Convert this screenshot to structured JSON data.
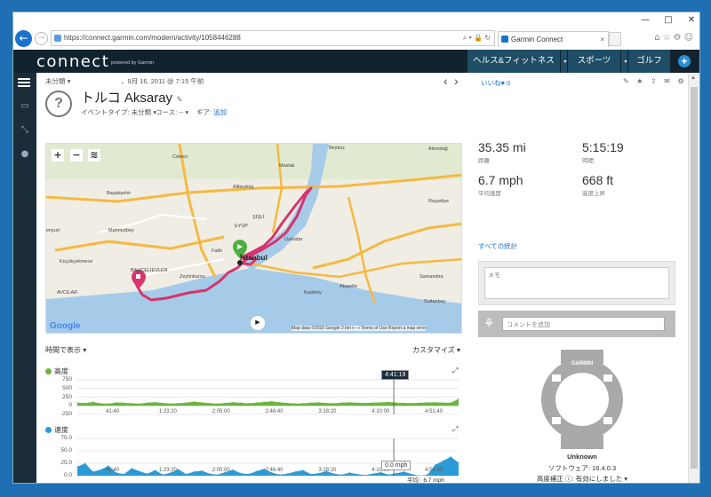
{
  "browser": {
    "url": "https://connect.garmin.com/modern/activity/1058446288",
    "tab_title": "Garmin Connect",
    "tab_close": "×",
    "back": "←",
    "forward": "→",
    "url_icons": "⌕ ▾ 🔒 ↻",
    "right_icons": "⌂☆⚙☺",
    "window_buttons": [
      "—",
      "□",
      "✕"
    ]
  },
  "header": {
    "logo": "connect",
    "logo_sub": "powered by Garmin",
    "nav": [
      "ヘルス&フィットネス",
      "スポーツ",
      "ゴルフ"
    ],
    "caret": "▾",
    "plus": "+"
  },
  "activity": {
    "category": "未分類",
    "category_caret": "▾",
    "date": "、9月 16, 2011 @ 7:15 午前",
    "title": "トルコ Aksaray",
    "edit_icon": "✎",
    "event_type_label": "イベントタイプ: 未分類 ▾",
    "course_label": "コース: -- ▾",
    "gear_label": "ギア:",
    "gear_add": "追加",
    "avatar": "?",
    "prev": "‹",
    "next": "›"
  },
  "social": {
    "like_label": "いいね",
    "heart": "♥",
    "like_count": "0",
    "actions": "✎ ★ ⇪ ✉ ⚙"
  },
  "map": {
    "zoom_in": "+",
    "zoom_out": "−",
    "layers": "≋",
    "play": "▶",
    "google": "Google",
    "attribution": "Map data ©2016 Google    2 km ⊢⊣    Terms of Use    Report a map error",
    "labels": [
      {
        "t": "Beykoz"
      },
      {
        "t": "Maslak"
      },
      {
        "t": "Cebeci"
      },
      {
        "t": "Alibeyköy"
      },
      {
        "t": "Başakşehir"
      },
      {
        "t": "Mahmutbey"
      },
      {
        "t": "enyurt"
      },
      {
        "t": "Küçükçekmece"
      },
      {
        "t": "AVCILAR"
      },
      {
        "t": "Zeytinburnu"
      },
      {
        "t": "Fatih"
      },
      {
        "t": "İstanbul"
      },
      {
        "t": "Üsküdar"
      },
      {
        "t": "Kadıköy"
      },
      {
        "t": "Ataşehir"
      },
      {
        "t": "Samandira"
      },
      {
        "t": "Sultanbey"
      },
      {
        "t": "Reşadiye"
      },
      {
        "t": "Alemdağ"
      },
      {
        "t": "BAHÇELİEVLER"
      },
      {
        "t": "ŞİŞLİ"
      },
      {
        "t": "EYÜP"
      }
    ]
  },
  "stats": {
    "distance": {
      "value": "35.35 mi",
      "label": "距離"
    },
    "time": {
      "value": "5:15:19",
      "label": "時間"
    },
    "avg_speed": {
      "value": "6.7 mph",
      "label": "平均速度"
    },
    "elev_gain": {
      "value": "668 ft",
      "label": "高度上昇"
    },
    "all_stats_link": "すべての統計"
  },
  "memo": {
    "placeholder": "メモ"
  },
  "comment": {
    "placeholder": "コメントを追加"
  },
  "charts_header": {
    "time_display": "時間で表示 ▾",
    "customize": "カスタマイズ ▾"
  },
  "colors": {
    "route": "#d6346e",
    "elevation": "#6db33f",
    "speed": "#2b9bd6",
    "header_bg": "#11232f",
    "nav_bg": "#1e4d65"
  },
  "chart_data": [
    {
      "type": "area",
      "title": "高度",
      "ylim": [
        -250,
        750
      ],
      "yticks": [
        "750",
        "500",
        "250",
        "0",
        "-250"
      ],
      "x": [
        "41:40",
        "1:23:20",
        "2:05:00",
        "2:46:40",
        "3:28:20",
        "4:10:00",
        "4:51:40"
      ],
      "cursor_label": "4:41:19",
      "values": [
        90,
        80,
        110,
        70,
        60,
        95,
        85,
        70,
        60,
        90,
        105,
        80,
        65,
        70,
        90,
        120,
        95,
        75,
        60,
        80,
        100,
        85,
        70,
        90,
        110,
        130,
        100,
        80,
        65,
        70,
        85,
        95,
        80,
        70,
        90,
        100,
        85,
        80,
        90,
        95,
        110,
        90,
        80,
        75,
        85,
        95,
        100,
        90,
        85,
        200
      ]
    },
    {
      "type": "area",
      "title": "速度",
      "ylim": [
        0,
        75
      ],
      "yticks": [
        "75.0",
        "50.0",
        "25.0",
        "0.0"
      ],
      "x": [
        "41:40",
        "1:23:20",
        "2:05:00",
        "2:46:40",
        "3:28:20",
        "4:10:00",
        "4:51:40"
      ],
      "cursor_label": "0.0 mph",
      "avg_label": "平均 : 6.7 mph",
      "values": [
        18,
        25,
        8,
        12,
        20,
        6,
        3,
        15,
        9,
        4,
        11,
        2,
        6,
        13,
        3,
        8,
        10,
        4,
        2,
        7,
        12,
        5,
        3,
        9,
        14,
        6,
        2,
        4,
        8,
        11,
        3,
        5,
        9,
        4,
        2,
        6,
        3,
        1,
        4,
        7,
        2,
        5,
        8,
        3,
        0,
        2,
        22,
        30,
        38,
        26
      ]
    }
  ],
  "device": {
    "name": "Unknown",
    "software": "ソフトウェア: 16.4.0.3",
    "elev_correction": "高度補正 ⓘ: 有効にしました ▾",
    "brand": "GARMIN"
  }
}
